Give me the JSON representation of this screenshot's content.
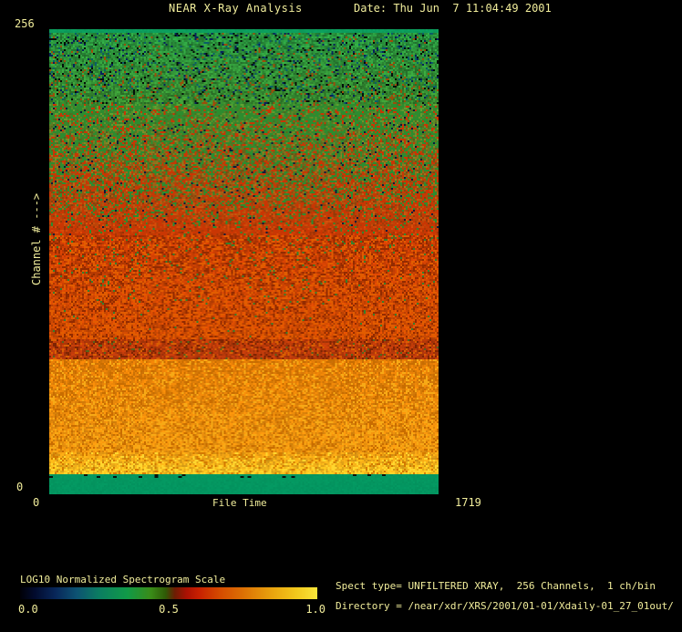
{
  "window": {
    "background": "#000000",
    "text_color": "#f1ed9b"
  },
  "header": {
    "title": "NEAR X-Ray Analysis",
    "date": "Date: Thu Jun  7 11:04:49 2001"
  },
  "info": {
    "spect_type": "Spect type= UNFILTERED XRAY,  256 Channels,  1 ch/bin",
    "directory": "Directory = /near/xdr/XRS/2001/01-01/Xdaily-01_27_01out/"
  },
  "chart_data": {
    "type": "heatmap",
    "title": "NEAR X-Ray Analysis",
    "xlabel": "File Time",
    "ylabel": "Channel # --->",
    "xlim": [
      0,
      1719
    ],
    "ylim": [
      0,
      256
    ],
    "x_ticks": [
      "0",
      "1719"
    ],
    "y_ticks": [
      "0",
      "256"
    ],
    "grid": false,
    "description": "Normalized X-ray spectrogram, 256 channels vs file time. Rendered as vertical bands of speckled noise from top (channel 256) to bottom (channel 0).",
    "bands": [
      {
        "name": "top-edge-solid-green",
        "channel_range": [
          254,
          256
        ],
        "from": 0.0,
        "to": 0.006,
        "top": "#0c9c5c",
        "bottom": "#0c9c5c",
        "jitter": 0.08,
        "speckles": []
      },
      {
        "name": "upper-green-noise",
        "channel_range": [
          215,
          254
        ],
        "from": 0.006,
        "to": 0.16,
        "top": "#27913d",
        "bottom": "#37892e",
        "jitter": 0.5,
        "speckles": [
          {
            "color": "#07235c",
            "density": [
              0.05,
              0.03
            ]
          },
          {
            "color": "#0b5e68",
            "density": [
              0.05,
              0.03
            ]
          },
          {
            "color": "#031008",
            "density": [
              0.06,
              0.05
            ]
          },
          {
            "color": "#9a4e0a",
            "density": [
              0.02,
              0.1
            ]
          }
        ]
      },
      {
        "name": "green-red-transition",
        "channel_range": [
          143,
          215
        ],
        "from": 0.16,
        "to": 0.44,
        "top": "#4f8a2b",
        "bottom": "#c03c05",
        "jitter": 0.4,
        "speckles": [
          {
            "color": "#2d8c2f",
            "density": [
              0.5,
              0.05
            ]
          },
          {
            "color": "#c93603",
            "density": [
              0.1,
              0.4
            ]
          },
          {
            "color": "#0a1c3c",
            "density": [
              0.04,
              0.01
            ]
          }
        ]
      },
      {
        "name": "red-noise",
        "channel_range": [
          86,
          143
        ],
        "from": 0.44,
        "to": 0.663,
        "top": "#c43a03",
        "bottom": "#cd4a02",
        "jitter": 0.32,
        "speckles": [
          {
            "color": "#e25c00",
            "density": [
              0.22,
              0.25
            ]
          },
          {
            "color": "#932b00",
            "density": [
              0.18,
              0.14
            ]
          },
          {
            "color": "#35802d",
            "density": [
              0.05,
              0.005
            ]
          }
        ]
      },
      {
        "name": "dark-red-band",
        "channel_range": [
          75,
          86
        ],
        "from": 0.663,
        "to": 0.708,
        "top": "#bb3a07",
        "bottom": "#b5380b",
        "jitter": 0.3,
        "speckles": [
          {
            "color": "#7e2402",
            "density": [
              0.16,
              0.16
            ]
          },
          {
            "color": "#d95f02",
            "density": [
              0.14,
              0.14
            ]
          },
          {
            "color": "#56641c",
            "density": [
              0.03,
              0.03
            ]
          }
        ]
      },
      {
        "name": "orange-band",
        "channel_range": [
          23,
          75
        ],
        "from": 0.708,
        "to": 0.908,
        "top": "#e27c06",
        "bottom": "#ea920e",
        "jitter": 0.24,
        "speckles": [
          {
            "color": "#c96d00",
            "density": [
              0.2,
              0.15
            ]
          },
          {
            "color": "#f7a916",
            "density": [
              0.15,
              0.24
            ]
          }
        ]
      },
      {
        "name": "bright-yellow-streaks",
        "channel_range": [
          11,
          23
        ],
        "from": 0.908,
        "to": 0.956,
        "top": "#ec9c12",
        "bottom": "#f2bc1e",
        "jitter": 0.28,
        "speckles": [
          {
            "color": "#ffd62e",
            "density": [
              0.08,
              0.34
            ]
          },
          {
            "color": "#d47a00",
            "density": [
              0.16,
              0.08
            ]
          }
        ]
      },
      {
        "name": "bottom-solid-green-strip",
        "channel_range": [
          0,
          11
        ],
        "from": 0.956,
        "to": 1.0,
        "top": "#049760",
        "bottom": "#039560",
        "jitter": 0.06,
        "speckles": [],
        "edge_dashes": {
          "color": "#06140c",
          "density": 0.045
        }
      }
    ],
    "colorbar": {
      "label": "LOG10 Normalized Spectrogram Scale",
      "ticks": [
        "0.0",
        "0.5",
        "1.0"
      ],
      "orientation": "horizontal",
      "gradient": [
        {
          "pos": 0.0,
          "color": "#000006"
        },
        {
          "pos": 0.05,
          "color": "#020b2e"
        },
        {
          "pos": 0.12,
          "color": "#08275a"
        },
        {
          "pos": 0.19,
          "color": "#0d5272"
        },
        {
          "pos": 0.27,
          "color": "#0b7f60"
        },
        {
          "pos": 0.36,
          "color": "#109a48"
        },
        {
          "pos": 0.44,
          "color": "#3a8c18"
        },
        {
          "pos": 0.49,
          "color": "#2f5a06"
        },
        {
          "pos": 0.52,
          "color": "#6b1d03"
        },
        {
          "pos": 0.56,
          "color": "#aa1103"
        },
        {
          "pos": 0.6,
          "color": "#c61f01"
        },
        {
          "pos": 0.67,
          "color": "#d44a00"
        },
        {
          "pos": 0.75,
          "color": "#dc7004"
        },
        {
          "pos": 0.85,
          "color": "#e9a40e"
        },
        {
          "pos": 0.93,
          "color": "#f2c81c"
        },
        {
          "pos": 1.0,
          "color": "#f8e63a"
        }
      ]
    }
  }
}
